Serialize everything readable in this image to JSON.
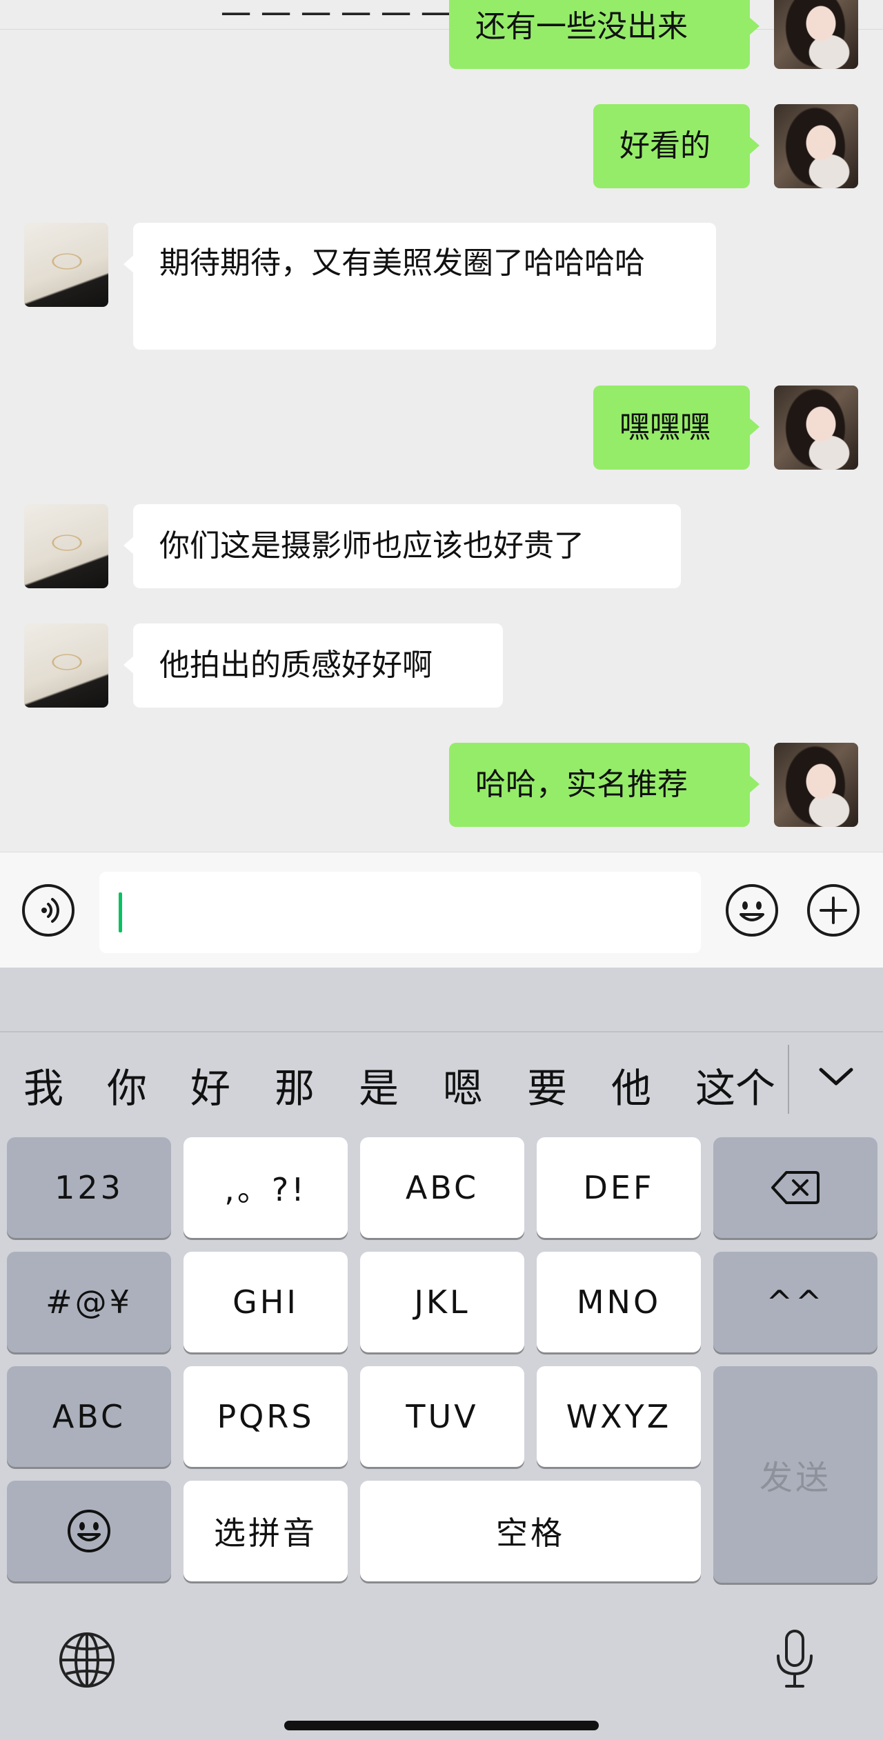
{
  "header": {
    "title_fragment": "一 一 一 一 一 一 一"
  },
  "messages": [
    {
      "side": "out",
      "text": "还有一些没出来"
    },
    {
      "side": "out",
      "text": "好看的"
    },
    {
      "side": "in",
      "text": "期待期待，又有美照发圈了哈哈哈哈"
    },
    {
      "side": "out",
      "text": "嘿嘿嘿"
    },
    {
      "side": "in",
      "text": "你们这是摄影师也应该也好贵了"
    },
    {
      "side": "in",
      "text": "他拍出的质感好好啊"
    },
    {
      "side": "out",
      "text": "哈哈，实名推荐"
    }
  ],
  "input": {
    "value": "",
    "voice_icon": "voice-icon",
    "emoji_icon": "emoji-icon",
    "plus_icon": "plus-icon"
  },
  "keyboard": {
    "candidates": [
      "我",
      "你",
      "好",
      "那",
      "是",
      "嗯",
      "要",
      "他",
      "这个"
    ],
    "rows": [
      [
        "123",
        ",。?!",
        "ABC",
        "DEF"
      ],
      [
        "#@¥",
        "GHI",
        "JKL",
        "MNO",
        "^^"
      ],
      [
        "ABC",
        "PQRS",
        "TUV",
        "WXYZ"
      ],
      [
        "选拼音",
        "空格"
      ]
    ],
    "send_label": "发送",
    "globe_icon": "globe-icon",
    "mic_icon": "mic-icon"
  },
  "colors": {
    "out_bubble": "#95ec69",
    "in_bubble": "#ffffff",
    "caret": "#07c160"
  }
}
